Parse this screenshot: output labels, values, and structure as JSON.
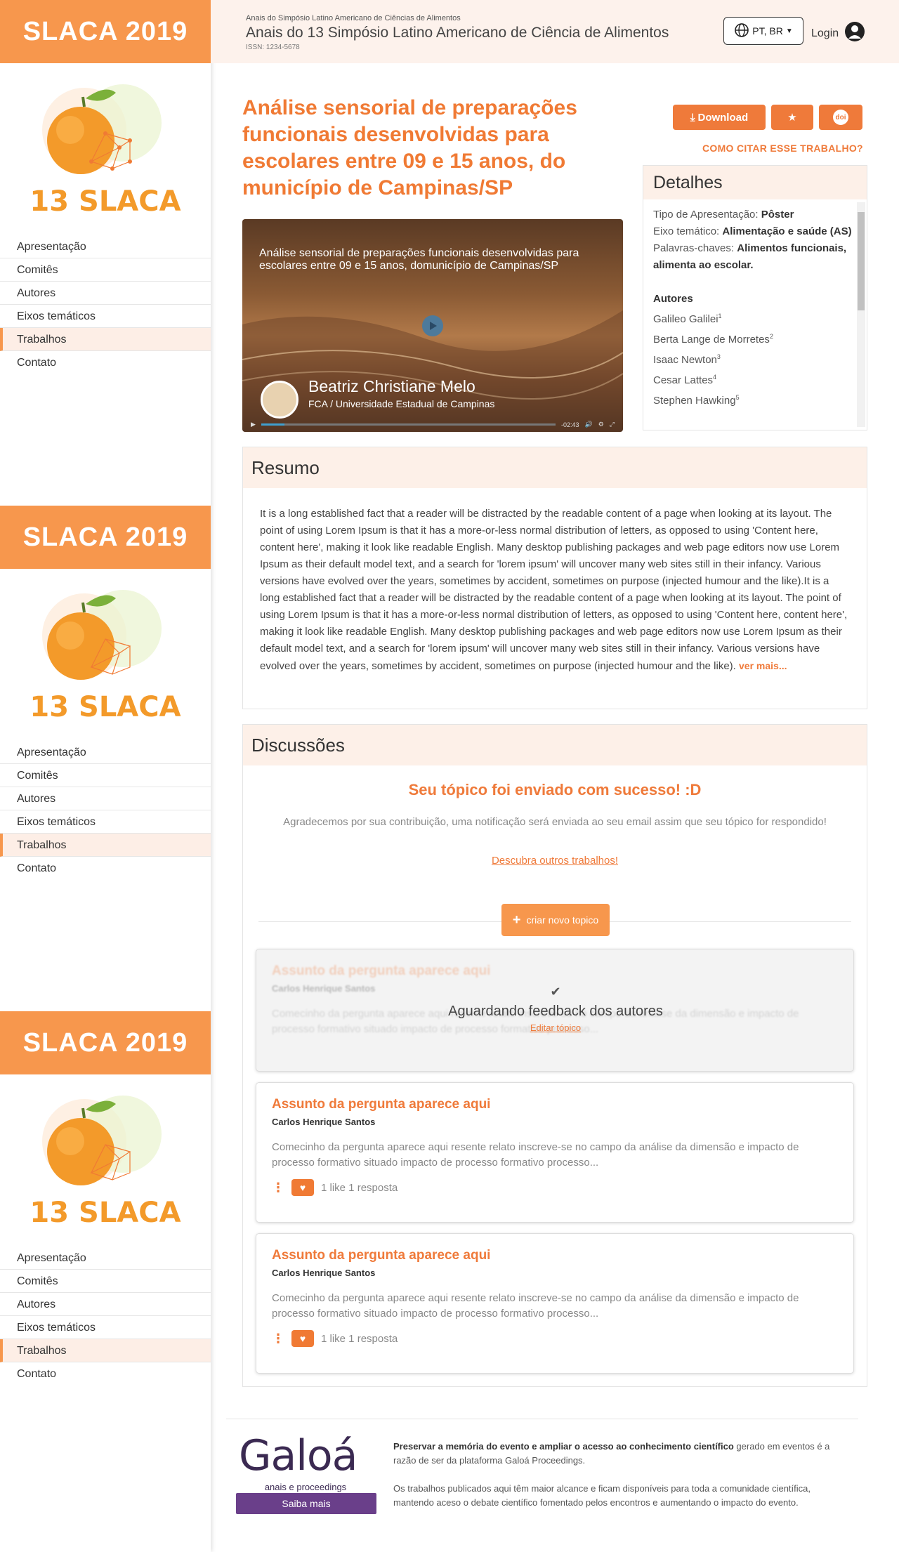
{
  "sidebar": {
    "brand": "SLACA 2019",
    "logo_text": "13 SLACA",
    "items": [
      {
        "label": "Apresentação"
      },
      {
        "label": "Comitês"
      },
      {
        "label": "Autores"
      },
      {
        "label": "Eixos temáticos"
      },
      {
        "label": "Trabalhos"
      },
      {
        "label": "Contato"
      }
    ],
    "active_item": "Trabalhos"
  },
  "header": {
    "subtitle": "Anais do Simpósio Latino Americano de Ciências de Alimentos",
    "title": "Anais do 13 Simpósio Latino Americano de Ciência de Alimentos",
    "issn": "ISSN: 1234-5678",
    "language": "PT, BR",
    "login": "Login"
  },
  "paper": {
    "title": "Análise sensorial de preparações funcionais desenvolvidas para escolares entre 09 e 15 anos, do município de Campinas/SP",
    "download_label": "Download",
    "doi_label": "doi",
    "cite_label": "COMO CITAR ESSE TRABALHO?"
  },
  "video": {
    "caption": "Análise sensorial de preparações funcionais desenvolvidas para escolares entre 09 e 15 anos, domunicípio de Campinas/SP",
    "presenter": "Beatriz Christiane Melo",
    "institution": "FCA / Universidade Estadual de Campinas",
    "time": "-02:43",
    "progress": 0.08
  },
  "details": {
    "heading": "Detalhes",
    "tipo_label": "Tipo de Apresentação:",
    "tipo_value": "Pôster",
    "eixo_label": "Eixo temático:",
    "eixo_value": "Alimentação e saúde (AS)",
    "palavras_label": "Palavras-chaves:",
    "palavras_value": "Alimentos funcionais, alimenta ao escolar.",
    "autores_heading": "Autores",
    "autores": [
      {
        "name": "Galileo Galilei",
        "sup": "1"
      },
      {
        "name": "Berta Lange de Morretes",
        "sup": "2"
      },
      {
        "name": "Isaac Newton",
        "sup": "3"
      },
      {
        "name": "Cesar Lattes",
        "sup": "4"
      },
      {
        "name": "Stephen Hawking",
        "sup": "5"
      }
    ]
  },
  "resumo": {
    "heading": "Resumo",
    "text": "It is a long established fact that a reader will be distracted by the readable content of a page when looking at its layout. The point of using Lorem Ipsum is that it has a more-or-less normal distribution of letters, as opposed to using 'Content here, content here', making it look like readable English. Many desktop publishing packages and web page editors now use Lorem Ipsum as their default model text, and a search for 'lorem ipsum' will uncover many web sites still in their infancy. Various versions have evolved over the years, sometimes by accident, sometimes on purpose (injected humour and the like).It is a long established fact that a reader will be distracted by the readable content of a page when looking at its layout. The point of using Lorem Ipsum is that it has a more-or-less normal distribution of letters, as opposed to using 'Content here, content here', making it look like readable English. Many desktop publishing packages and web page editors now use Lorem Ipsum as their default model text, and a search for 'lorem ipsum' will uncover many web sites still in their infancy. Various versions have evolved over the years, sometimes by accident, sometimes on purpose (injected humour and the like).",
    "more_label": "ver mais..."
  },
  "discussoes": {
    "heading": "Discussões",
    "success": "Seu tópico foi enviado com sucesso! :D",
    "thanks": "Agradecemos por sua contribuição, uma notificação será enviada ao seu email assim que seu tópico for respondido!",
    "descubra": "Descubra outros trabalhos!",
    "new_topic": "criar novo topico",
    "pending": {
      "title": "Assunto da pergunta aparece aqui",
      "author": "Carlos Henrique Santos",
      "text": "Comecinho da pergunta aparece aqui resente relato inscreve-se no campo da análise da dimensão e impacto de processo formativo situado impacto de processo formativo processo...",
      "status": "Aguardando feedback dos autores",
      "edit": "Editar tópico"
    },
    "topics": [
      {
        "title": "Assunto da pergunta aparece aqui",
        "author": "Carlos Henrique Santos",
        "text": "Comecinho da pergunta aparece aqui resente relato inscreve-se no campo da análise da dimensão e impacto de processo formativo situado impacto de processo formativo processo...",
        "stats": "1 like 1 resposta"
      },
      {
        "title": "Assunto da pergunta aparece aqui",
        "author": "Carlos Henrique Santos",
        "text": "Comecinho da pergunta aparece aqui resente relato inscreve-se no campo da análise da dimensão e impacto de processo formativo situado impacto de processo formativo processo...",
        "stats": "1 like 1 resposta"
      }
    ]
  },
  "footer": {
    "brand": "Galoá",
    "brand_sub": "anais e proceedings",
    "button": "Saiba mais",
    "text1_bold": "Preservar a memória do evento e ampliar o acesso ao conhecimento científico",
    "text1_rest": " gerado em eventos é a razão de ser da plataforma Galoá Proceedings.",
    "text2": "Os trabalhos publicados aqui têm maior alcance e ficam disponíveis para toda a comunidade científica, mantendo aceso o debate científico fomentado pelos encontros e aumentando o impacto do evento."
  },
  "colors": {
    "accent": "#ef7a3a",
    "brand_bar": "#f7974d",
    "panel_header": "#fdf0e8",
    "galoa": "#3b2a52"
  }
}
